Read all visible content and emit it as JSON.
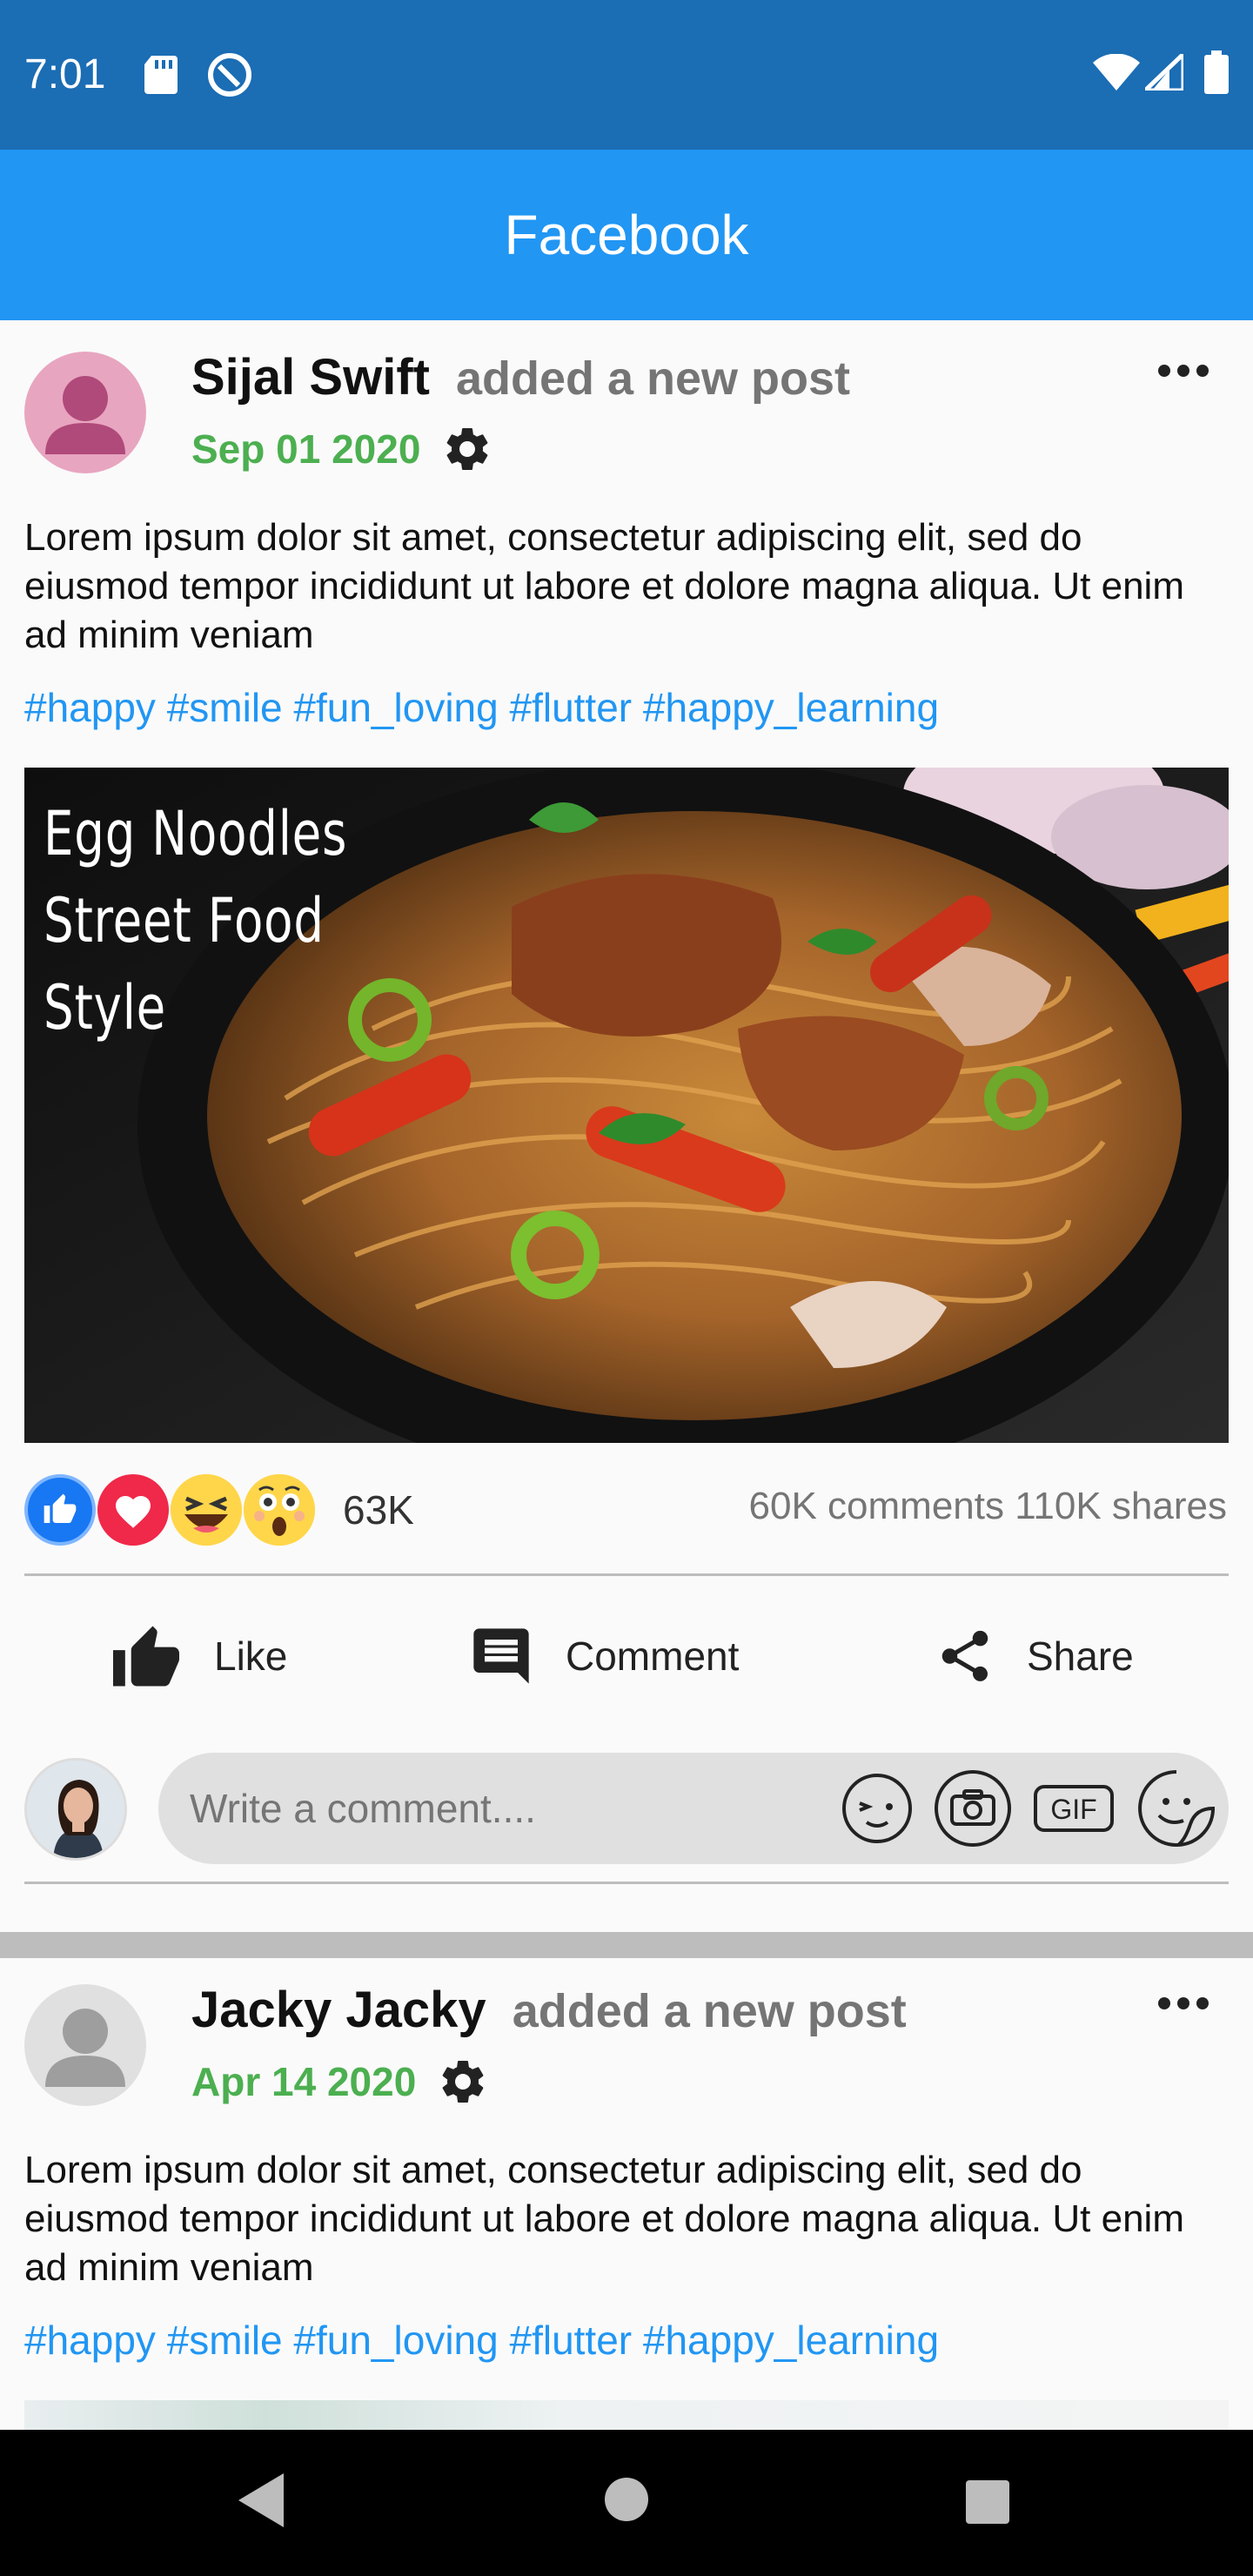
{
  "status_bar": {
    "time": "7:01",
    "icons": [
      "sd-card-icon",
      "do-not-disturb-icon",
      "wifi-icon",
      "cell-signal-icon",
      "battery-icon"
    ]
  },
  "app_bar": {
    "title": "Facebook",
    "color": "#2196f3"
  },
  "posts": [
    {
      "author": "Sijal Swift",
      "action_text": "added a new post",
      "date": "Sep 01 2020",
      "body": "Lorem ipsum dolor sit amet, consectetur adipiscing elit, sed do eiusmod tempor incididunt ut labore et dolore magna aliqua. Ut enim ad minim veniam",
      "tags": "#happy #smile #fun_loving #flutter #happy_learning",
      "image_caption": "Egg Noodles\nStreet Food\nStyle",
      "reaction_count": "63K",
      "stats": "60K comments 110K shares",
      "actions": {
        "like": "Like",
        "comment": "Comment",
        "share": "Share"
      },
      "comment_placeholder": "Write a comment...."
    },
    {
      "author": "Jacky Jacky",
      "action_text": "added a new post",
      "date": "Apr 14 2020",
      "body": "Lorem ipsum dolor sit amet, consectetur adipiscing elit, sed do eiusmod tempor incididunt ut labore et dolore magna aliqua. Ut enim ad minim veniam",
      "tags": "#happy #smile #fun_loving #flutter #happy_learning"
    }
  ],
  "colors": {
    "date_green": "#4caf50",
    "tag_blue": "#2196f3",
    "status_bar": "#1b6db4"
  }
}
